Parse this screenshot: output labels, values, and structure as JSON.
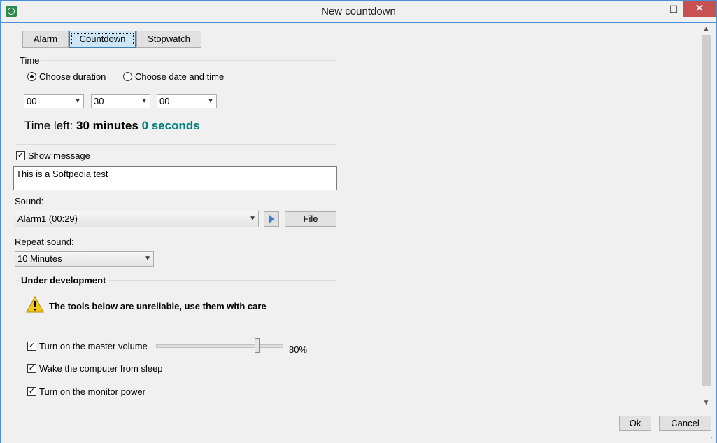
{
  "window": {
    "title": "New countdown",
    "controls": {
      "minimize": "—",
      "maximize": "☐",
      "close": "✕"
    }
  },
  "tabs": [
    {
      "label": "Alarm",
      "selected": false
    },
    {
      "label": "Countdown",
      "selected": true
    },
    {
      "label": "Stopwatch",
      "selected": false
    }
  ],
  "time": {
    "group_label": "Time",
    "mode_duration": "Choose duration",
    "mode_datetime": "Choose date and time",
    "selected_mode": "duration",
    "hours": "00",
    "minutes": "30",
    "seconds": "00",
    "time_left_label": "Time left:",
    "time_left_minutes": "30 minutes",
    "time_left_seconds": "0 seconds"
  },
  "message": {
    "checkbox_label": "Show message",
    "checked": true,
    "text": "This is a Softpedia test"
  },
  "sound": {
    "label": "Sound:",
    "selected": "Alarm1 (00:29)",
    "file_button": "File"
  },
  "repeat": {
    "label": "Repeat sound:",
    "selected": "10 Minutes"
  },
  "dev": {
    "group_label": "Under development",
    "warning": "The tools below are unreliable, use them with care",
    "master_volume_label": "Turn on the master volume",
    "master_volume_checked": true,
    "volume_value": 0.8,
    "volume_text": "80%",
    "wake_label": "Wake the computer from sleep",
    "wake_checked": true,
    "monitor_label": "Turn on the monitor power",
    "monitor_checked": true
  },
  "footer": {
    "ok": "Ok",
    "cancel": "Cancel"
  },
  "colors": {
    "accent_blue": "#4a90d9",
    "seconds_teal": "#008080",
    "close_red": "#c75050",
    "warning_yellow": "#f5c518"
  }
}
